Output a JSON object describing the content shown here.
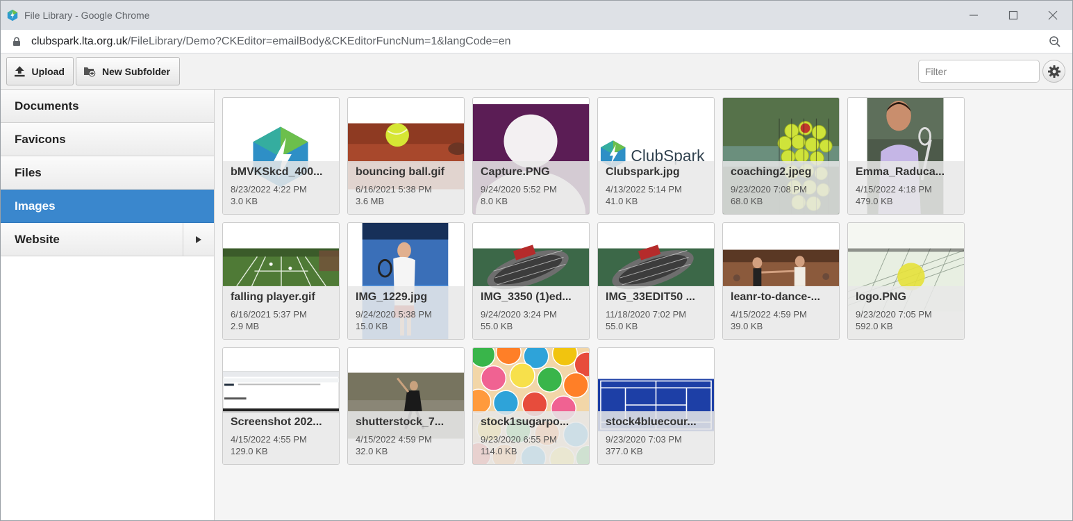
{
  "window": {
    "title": "File Library - Google Chrome"
  },
  "addressbar": {
    "host": "clubspark.lta.org.uk",
    "path": "/FileLibrary/Demo?CKEditor=emailBody&CKEditorFuncNum=1&langCode=en"
  },
  "toolbar": {
    "upload_label": "Upload",
    "new_subfolder_label": "New Subfolder",
    "filter_placeholder": "Filter"
  },
  "sidebar": {
    "items": [
      {
        "label": "Documents"
      },
      {
        "label": "Favicons"
      },
      {
        "label": "Files"
      },
      {
        "label": "Images"
      },
      {
        "label": "Website"
      }
    ],
    "active_index": 3,
    "active_color": "#3a87cd"
  },
  "files": [
    {
      "name": "bMVKSkcd_400...",
      "date": "8/23/2022 4:22 PM",
      "size": "3.0 KB"
    },
    {
      "name": "bouncing ball.gif",
      "date": "6/16/2021 5:38 PM",
      "size": "3.6 MB"
    },
    {
      "name": "Capture.PNG",
      "date": "9/24/2020 5:52 PM",
      "size": "8.0 KB"
    },
    {
      "name": "Clubspark.jpg",
      "date": "4/13/2022 5:14 PM",
      "size": "41.0 KB",
      "logo_text": "ClubSpark"
    },
    {
      "name": "coaching2.jpeg",
      "date": "9/23/2020 7:08 PM",
      "size": "68.0 KB"
    },
    {
      "name": "Emma_Raduca...",
      "date": "4/15/2022 4:18 PM",
      "size": "479.0 KB"
    },
    {
      "name": "falling player.gif",
      "date": "6/16/2021 5:37 PM",
      "size": "2.9 MB"
    },
    {
      "name": "IMG_1229.jpg",
      "date": "9/24/2020 5:38 PM",
      "size": "15.0 KB"
    },
    {
      "name": "IMG_3350 (1)ed...",
      "date": "9/24/2020 3:24 PM",
      "size": "55.0 KB"
    },
    {
      "name": "IMG_33EDIT50 ...",
      "date": "11/18/2020 7:02 PM",
      "size": "55.0 KB"
    },
    {
      "name": "leanr-to-dance-...",
      "date": "4/15/2022 4:59 PM",
      "size": "39.0 KB"
    },
    {
      "name": "logo.PNG",
      "date": "9/23/2020 7:05 PM",
      "size": "592.0 KB"
    },
    {
      "name": "Screenshot 202...",
      "date": "4/15/2022 4:55 PM",
      "size": "129.0 KB"
    },
    {
      "name": "shutterstock_7...",
      "date": "4/15/2022 4:59 PM",
      "size": "32.0 KB"
    },
    {
      "name": "stock1sugarpo...",
      "date": "9/23/2020 6:55 PM",
      "size": "114.0 KB"
    },
    {
      "name": "stock4bluecour...",
      "date": "9/23/2020 7:03 PM",
      "size": "377.0 KB"
    }
  ]
}
